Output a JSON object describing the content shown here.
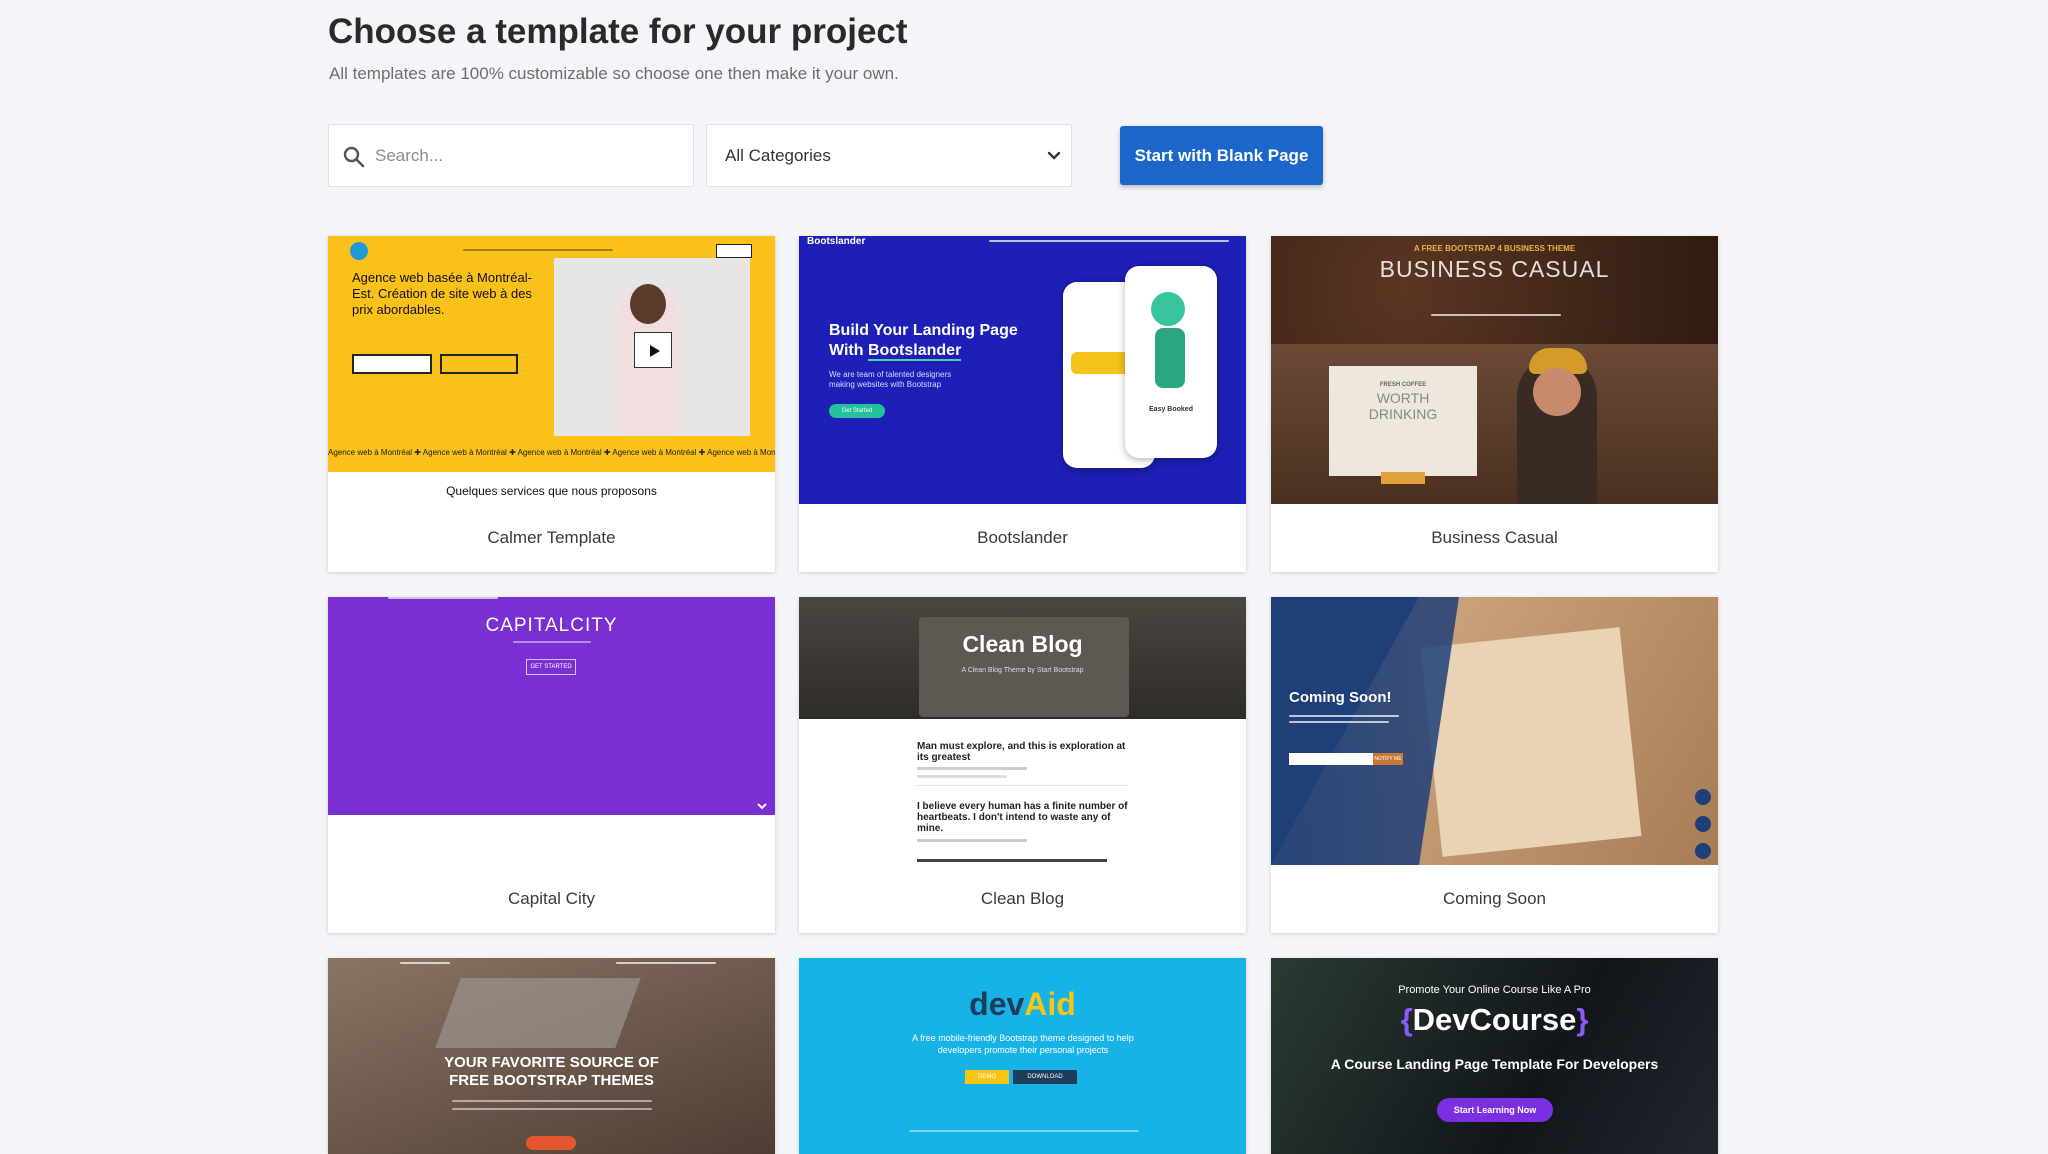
{
  "header": {
    "title": "Choose a template for your project",
    "subtitle": "All templates are 100% customizable so choose one then make it your own."
  },
  "toolbar": {
    "search_placeholder": "Search...",
    "search_icon": "search-icon",
    "category_selected": "All Categories",
    "blank_button_label": "Start with Blank Page"
  },
  "templates": [
    {
      "name": "Calmer Template",
      "preview": {
        "headline": "Agence web basée à Montréal-Est. Création de site web à des prix abordables.",
        "ticker": "Agence web à Montréal",
        "footer_text": "Quelques services que nous proposons"
      }
    },
    {
      "name": "Bootslander",
      "preview": {
        "brand": "Bootslander",
        "headline_line1": "Build Your Landing Page",
        "headline_line2_prefix": "With ",
        "headline_line2_brand": "Bootslander",
        "text": "We are team of talented designers making websites with Bootstrap",
        "button": "Get Started",
        "card_label": "Easy Booked"
      }
    },
    {
      "name": "Business Casual",
      "preview": {
        "kicker": "A FREE BOOTSTRAP 4 BUSINESS THEME",
        "title": "BUSINESS CASUAL",
        "box_line1": "FRESH COFFEE",
        "box_line2": "WORTH",
        "box_line3": "DRINKING"
      }
    },
    {
      "name": "Capital City",
      "preview": {
        "title": "CAPITALCITY",
        "button": "GET STARTED"
      }
    },
    {
      "name": "Clean Blog",
      "preview": {
        "title": "Clean Blog",
        "subtitle": "A Clean Blog Theme by Start Bootstrap",
        "post1": "Man must explore, and this is exploration at its greatest",
        "post2": "I believe every human has a finite number of heartbeats. I don't intend to waste any of mine."
      }
    },
    {
      "name": "Coming Soon",
      "preview": {
        "title": "Coming Soon!",
        "button": "NOTIFY ME"
      }
    },
    {
      "name": "",
      "preview": {
        "title_line1": "YOUR FAVORITE SOURCE OF",
        "title_line2": "FREE BOOTSTRAP THEMES"
      }
    },
    {
      "name": "",
      "preview": {
        "title_a": "dev",
        "title_b": "Aid",
        "text": "A free mobile-friendly Bootstrap theme designed to help developers promote their personal projects",
        "button1": "DEMO",
        "button2": "DOWNLOAD"
      }
    },
    {
      "name": "",
      "preview": {
        "kicker": "Promote Your Online Course Like A Pro",
        "title": "DevCourse",
        "subtitle": "A Course Landing Page Template For Developers",
        "button": "Start Learning Now"
      }
    }
  ],
  "colors": {
    "primary_button": "#1b67c9",
    "page_background": "#f4f5f8"
  }
}
